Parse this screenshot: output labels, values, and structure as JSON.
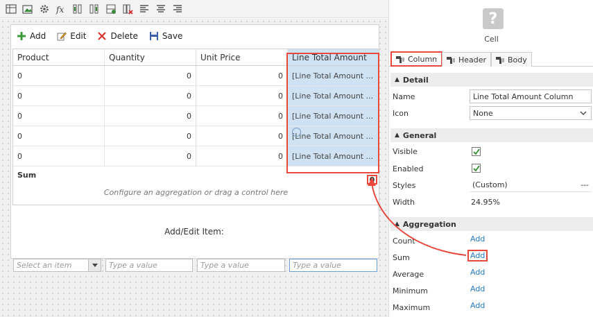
{
  "toolbar_icons": [
    "table-icon",
    "add-image-icon",
    "gear-icon",
    "function-icon",
    "insert-column-left-icon",
    "insert-column-right-icon",
    "insert-row-icon",
    "delete-column-icon",
    "align-left-icon",
    "align-center-icon",
    "align-right-icon"
  ],
  "grid_toolbar": {
    "add": "Add",
    "edit": "Edit",
    "delete": "Delete",
    "save": "Save"
  },
  "grid": {
    "headers": [
      "Product",
      "Quantity",
      "Unit Price",
      "Line Total Amount"
    ],
    "rows": [
      [
        "0",
        "0",
        "0",
        "[Line Total Amount ..."
      ],
      [
        "0",
        "0",
        "0",
        "[Line Total Amount ..."
      ],
      [
        "0",
        "0",
        "0",
        "[Line Total Amount ..."
      ],
      [
        "0",
        "0",
        "0",
        "[Line Total Amount ..."
      ],
      [
        "0",
        "0",
        "0",
        "[Line Total Amount ..."
      ]
    ],
    "sum_label": "Sum",
    "sum_value": "0",
    "aggregation_hint": "Configure an aggregation or drag a control here"
  },
  "add_edit": {
    "label": "Add/Edit Item:",
    "select_placeholder": "Select an item",
    "value_placeholder": "Type a value"
  },
  "panel": {
    "cell_label": "Cell",
    "tabs": [
      "Column",
      "Header",
      "Body"
    ],
    "detail": {
      "title": "Detail",
      "name_label": "Name",
      "name_value": "Line Total Amount Column",
      "icon_label": "Icon",
      "icon_value": "None"
    },
    "general": {
      "title": "General",
      "visible_label": "Visible",
      "enabled_label": "Enabled",
      "styles_label": "Styles",
      "styles_value": "(Custom)",
      "styles_more": "---",
      "width_label": "Width",
      "width_value": "24.95%"
    },
    "aggregation": {
      "title": "Aggregation",
      "items": [
        {
          "label": "Count",
          "action": "Add"
        },
        {
          "label": "Sum",
          "action": "Add"
        },
        {
          "label": "Average",
          "action": "Add"
        },
        {
          "label": "Minimum",
          "action": "Add"
        },
        {
          "label": "Maximum",
          "action": "Add"
        }
      ]
    }
  },
  "colors": {
    "highlight": "#e8473b",
    "selected_column": "#cfe2f3",
    "link": "#1b7ac9"
  }
}
